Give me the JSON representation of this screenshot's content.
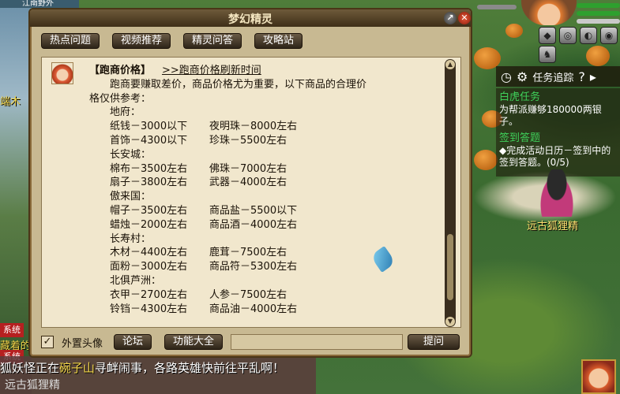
{
  "window": {
    "title": "梦幻精灵"
  },
  "tabs": [
    "热点问题",
    "视频推荐",
    "精灵问答",
    "攻略站"
  ],
  "article": {
    "heading": "【跑商价格】",
    "link": ">>跑商价格刷新时间",
    "intro_line1": "跑商要赚取差价，商品价格尤为重要，以下商品的合理价",
    "intro_line2": "格仅供参考：",
    "regions": [
      {
        "name": "地府：",
        "items": [
          [
            "纸钱－3000以下",
            "夜明珠－8000左右"
          ],
          [
            "首饰－4300以下",
            "珍珠－5500左右"
          ]
        ]
      },
      {
        "name": "长安城：",
        "items": [
          [
            "棉布－3500左右",
            "佛珠－7000左右"
          ],
          [
            "扇子－3800左右",
            "武器－4000左右"
          ]
        ]
      },
      {
        "name": "傲来国：",
        "items": [
          [
            "帽子－3500左右",
            "商品盐－5500以下"
          ],
          [
            "蜡烛－2000左右",
            "商品酒－4000左右"
          ]
        ]
      },
      {
        "name": "长寿村：",
        "items": [
          [
            "木材－4400左右",
            "鹿茸－7500左右"
          ],
          [
            "面粉－3000左右",
            "商品符－5300左右"
          ]
        ]
      },
      {
        "name": "北俱芦洲：",
        "items": [
          [
            "衣甲－2700左右",
            "人参－7500左右"
          ],
          [
            "铃铛－4300左右",
            "商品油－4000左右"
          ]
        ]
      }
    ]
  },
  "bottom": {
    "checkbox_label": "外置头像",
    "checkbox_checked": "✓",
    "forum_button": "论坛",
    "features_button": "功能大全",
    "ask_button": "提问",
    "input_value": ""
  },
  "hud": {
    "top_left_area": "江南野外",
    "track_label": "任务追踪",
    "tasks": [
      {
        "title": "白虎任务",
        "desc": "为帮派赚够180000两银子。"
      },
      {
        "title": "签到答题",
        "desc": "◆完成活动日历－签到中的签到答题。(0/5)"
      }
    ],
    "npc_name": "远古狐狸精"
  },
  "chat": {
    "line1_prefix": "狐妖怪正在",
    "line1_place": "碗子山",
    "line1_suffix": "寻衅闹事，各路英雄快前往平乱啊！",
    "line2": "远古狐狸精",
    "side_labels": [
      "系统",
      "系统"
    ],
    "side_texts": [
      "端木",
      "藏着的"
    ]
  }
}
